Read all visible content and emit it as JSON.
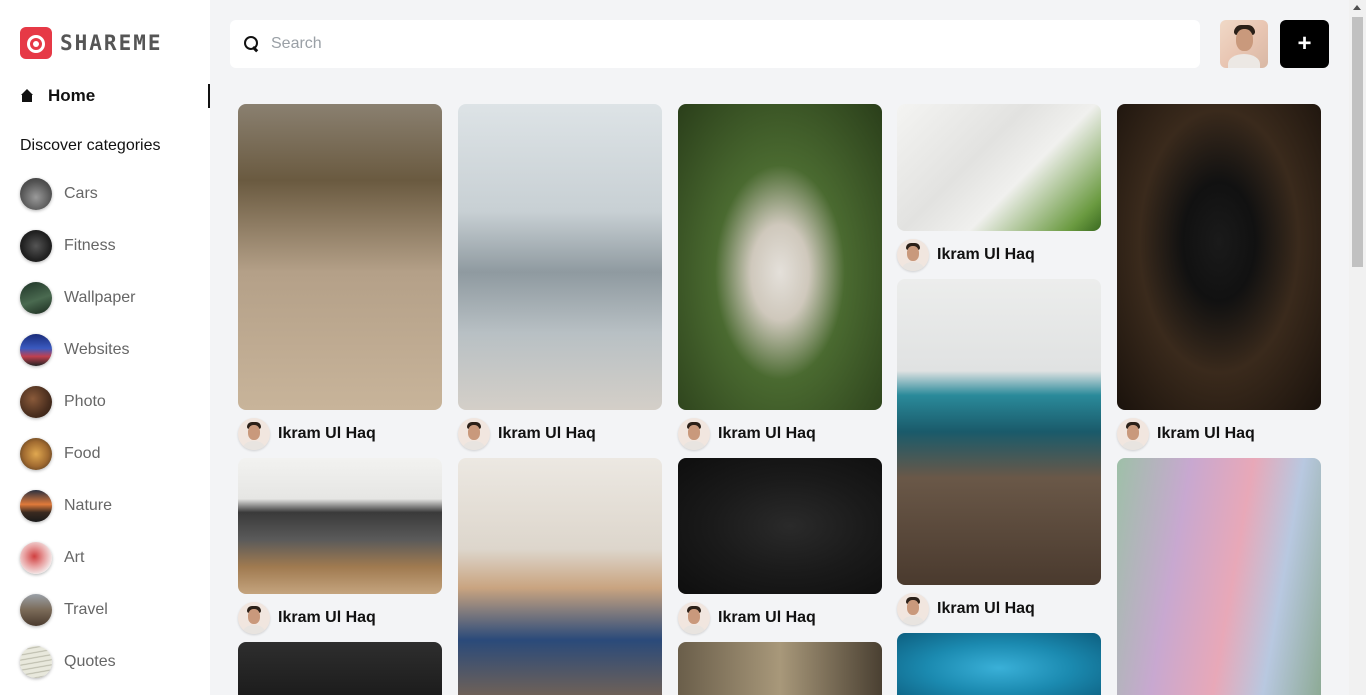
{
  "app": {
    "name": "SHAREME"
  },
  "sidebar": {
    "home_label": "Home",
    "discover_label": "Discover categories",
    "categories": [
      {
        "label": "Cars",
        "color": "#6b6b6b"
      },
      {
        "label": "Fitness",
        "color": "#2b2b2b"
      },
      {
        "label": "Wallpaper",
        "color": "#2f4a3a"
      },
      {
        "label": "Websites",
        "color": "#2a3a7a"
      },
      {
        "label": "Photo",
        "color": "#5a3a2a"
      },
      {
        "label": "Food",
        "color": "#b07a3a"
      },
      {
        "label": "Nature",
        "color": "#c06a3a"
      },
      {
        "label": "Art",
        "color": "#c43a3a"
      },
      {
        "label": "Travel",
        "color": "#7a6a5a"
      },
      {
        "label": "Quotes",
        "color": "#cfcfc0"
      }
    ]
  },
  "search": {
    "placeholder": "Search",
    "value": ""
  },
  "header": {
    "add_label": "+"
  },
  "pins": [
    {
      "name": "pin-couple-forest",
      "user": "Ikram Ul Haq",
      "colors": [
        "#b49a7e",
        "#8a6a4e"
      ]
    },
    {
      "name": "pin-couple-beach",
      "user": "Ikram Ul Haq",
      "colors": [
        "#c9d3d6",
        "#8e9aa0"
      ]
    },
    {
      "name": "pin-woman-grass",
      "user": "Ikram Ul Haq",
      "colors": [
        "#3f5a28",
        "#26381a"
      ]
    },
    {
      "name": "pin-think-outside-box",
      "user": "Ikram Ul Haq",
      "colors": [
        "#eeeeee",
        "#bdbdbd"
      ]
    },
    {
      "name": "pin-win-mug",
      "user": "Ikram Ul Haq",
      "colors": [
        "#2a1f17",
        "#0f0b08"
      ]
    },
    {
      "name": "pin-desk-monitors",
      "user": "Ikram Ul Haq",
      "colors": [
        "#e8e8e6",
        "#7a5a3e"
      ]
    },
    {
      "name": "pin-imac-desk",
      "user": "Ikram Ul Haq",
      "colors": [
        "#e7e7e5",
        "#5b4a3c"
      ]
    },
    {
      "name": "pin-flatlay-dark",
      "user": "Ikram Ul Haq",
      "colors": [
        "#1c1c1c",
        "#0e0e0e"
      ]
    },
    {
      "name": "pin-artist-apron",
      "user": "",
      "colors": [
        "#e9e4dc",
        "#b8aea0"
      ]
    },
    {
      "name": "pin-paint-brushes",
      "user": "",
      "colors": [
        "#a8c4b0",
        "#d8a0b8"
      ]
    },
    {
      "name": "pin-dark-devices",
      "user": "",
      "colors": [
        "#2a2a2a",
        "#151515"
      ]
    },
    {
      "name": "pin-building",
      "user": "",
      "colors": [
        "#8a7a60",
        "#4a4032"
      ]
    },
    {
      "name": "pin-swimmer-pool",
      "user": "",
      "colors": [
        "#1b8ab0",
        "#0d5f80"
      ]
    }
  ]
}
